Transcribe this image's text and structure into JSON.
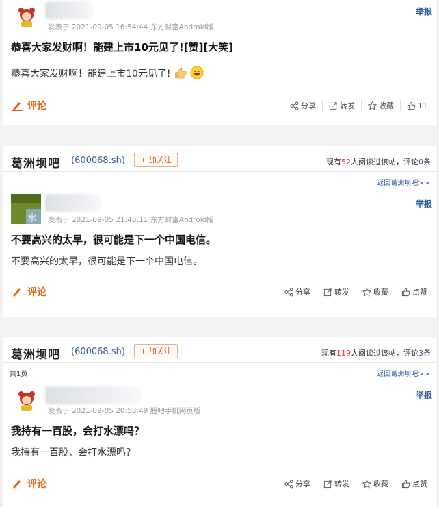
{
  "posts": [
    {
      "meta": "发表于 2021-09-05 16:54:44 东方财富Android版",
      "report": "举报",
      "title": "恭喜大家发财啊！能建上市10元见了![赞][大笑]",
      "body": "恭喜大家发财啊！能建上市10元见了!",
      "comment": "评论",
      "actions": {
        "share": "分享",
        "forward": "转发",
        "favorite": "收藏",
        "like": "11"
      }
    },
    {
      "meta": "发表于 2021-09-05 21:48:11 东方财富Android版",
      "report": "举报",
      "title": "不要高兴的太早，很可能是下一个中国电信。",
      "body": "不要高兴的太早，很可能是下一个中国电信。",
      "comment": "评论",
      "actions": {
        "share": "分享",
        "forward": "转发",
        "favorite": "收藏",
        "like": "点赞"
      }
    },
    {
      "meta": "发表于 2021-09-05 20:58:49 股吧手机网页版",
      "report": "举报",
      "title": "我持有一百股，会打水漂吗？",
      "body": "我持有一百股，会打水漂吗？",
      "comment": "评论",
      "actions": {
        "share": "分享",
        "forward": "转发",
        "favorite": "收藏",
        "like": "点赞"
      }
    }
  ],
  "bars": [
    {
      "title": "葛洲坝吧",
      "code": "(600068.sh)",
      "follow": "+ 加关注",
      "read_prefix": "现有",
      "read_count": "52",
      "read_mid": "人阅读过该帖，评论",
      "comment_count": "0",
      "read_suffix": "条",
      "back": "返回葛洲坝吧>>"
    },
    {
      "title": "葛洲坝吧",
      "code": "(600068.sh)",
      "follow": "+ 加关注",
      "read_prefix": "现有",
      "read_count": "119",
      "read_mid": "人阅读过该帖，评论",
      "comment_count": "3",
      "read_suffix": "条",
      "pages": "共1页",
      "back": "返回葛洲坝吧>>"
    }
  ],
  "colors": {
    "link": "#2d5b9a",
    "accent": "#e85d12",
    "count": "#ee3333"
  }
}
